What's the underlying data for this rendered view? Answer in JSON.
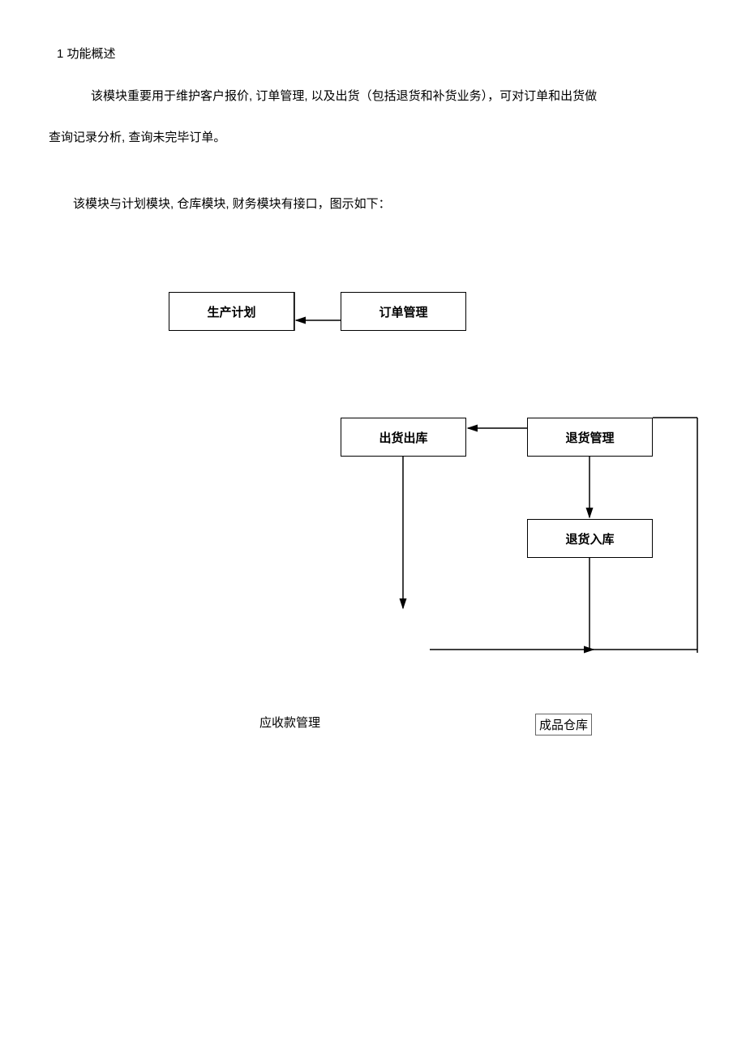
{
  "heading": "1 功能概述",
  "paragraph1a": "该模块重要用于维护客户报价, 订单管理, 以及出货（包括退货和补货业务），可对订单和出货做",
  "paragraph1b": "查询记录分析, 查询未完毕订单。",
  "paragraph2": "该模块与计划模块, 仓库模块, 财务模块有接口，图示如下：",
  "diagram": {
    "nodes": {
      "production_plan": "生产计划",
      "order_mgmt": "订单管理",
      "ship_out": "出货出库",
      "return_mgmt": "退货管理",
      "return_in": "退货入库"
    },
    "labels": {
      "receivable": "应收款管理",
      "finished_warehouse": "成品仓库"
    },
    "edges": [
      {
        "from": "order_mgmt",
        "to": "production_plan"
      },
      {
        "from": "return_mgmt",
        "to": "ship_out"
      },
      {
        "from": "return_mgmt",
        "to": "return_in"
      },
      {
        "from": "ship_out",
        "to": "down"
      },
      {
        "from": "return_in",
        "to": "down_right"
      },
      {
        "from": "right_edge",
        "to": "bottom_merge"
      }
    ]
  }
}
